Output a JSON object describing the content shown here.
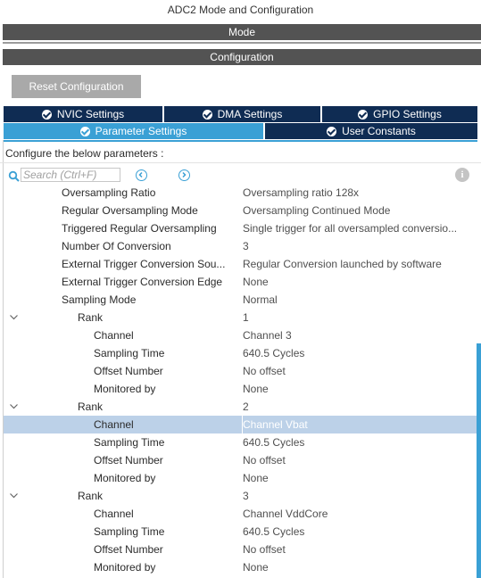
{
  "window_title": "ADC2 Mode and Configuration",
  "mode_bar": "Mode",
  "config_bar": "Configuration",
  "reset_button": "Reset Configuration",
  "tabs": {
    "nvic": "NVIC Settings",
    "dma": "DMA Settings",
    "gpio": "GPIO Settings",
    "parameter": "Parameter Settings",
    "user_constants": "User Constants"
  },
  "configure_text": "Configure the below parameters :",
  "search": {
    "placeholder": "Search (Ctrl+F)"
  },
  "colors": {
    "tab_dark": "#0f2c53",
    "tab_active": "#3aa0d5",
    "bar_gray": "#535353",
    "selected_row": "#bcd1e8"
  },
  "params": [
    {
      "name": "Oversampling Ratio",
      "value": "Oversampling ratio 128x"
    },
    {
      "name": "Regular Oversampling Mode",
      "value": "Oversampling Continued Mode"
    },
    {
      "name": "Triggered Regular Oversampling",
      "value": "Single trigger for all oversampled conversio..."
    },
    {
      "name": "Number Of Conversion",
      "value": "3"
    },
    {
      "name": "External Trigger Conversion Sou...",
      "value": "Regular Conversion launched by software"
    },
    {
      "name": "External Trigger Conversion Edge",
      "value": "None"
    },
    {
      "name": "Sampling Mode",
      "value": "Normal"
    },
    {
      "name": "Rank",
      "value": "1"
    },
    {
      "name": "Channel",
      "value": "Channel 3"
    },
    {
      "name": "Sampling Time",
      "value": "640.5 Cycles"
    },
    {
      "name": "Offset Number",
      "value": "No offset"
    },
    {
      "name": "Monitored by",
      "value": "None"
    },
    {
      "name": "Rank",
      "value": "2"
    },
    {
      "name": "Channel",
      "value": "Channel Vbat"
    },
    {
      "name": "Sampling Time",
      "value": "640.5 Cycles"
    },
    {
      "name": "Offset Number",
      "value": "No offset"
    },
    {
      "name": "Monitored by",
      "value": "None"
    },
    {
      "name": "Rank",
      "value": "3"
    },
    {
      "name": "Channel",
      "value": "Channel VddCore"
    },
    {
      "name": "Sampling Time",
      "value": "640.5 Cycles"
    },
    {
      "name": "Offset Number",
      "value": "No offset"
    },
    {
      "name": "Monitored by",
      "value": "None"
    }
  ]
}
